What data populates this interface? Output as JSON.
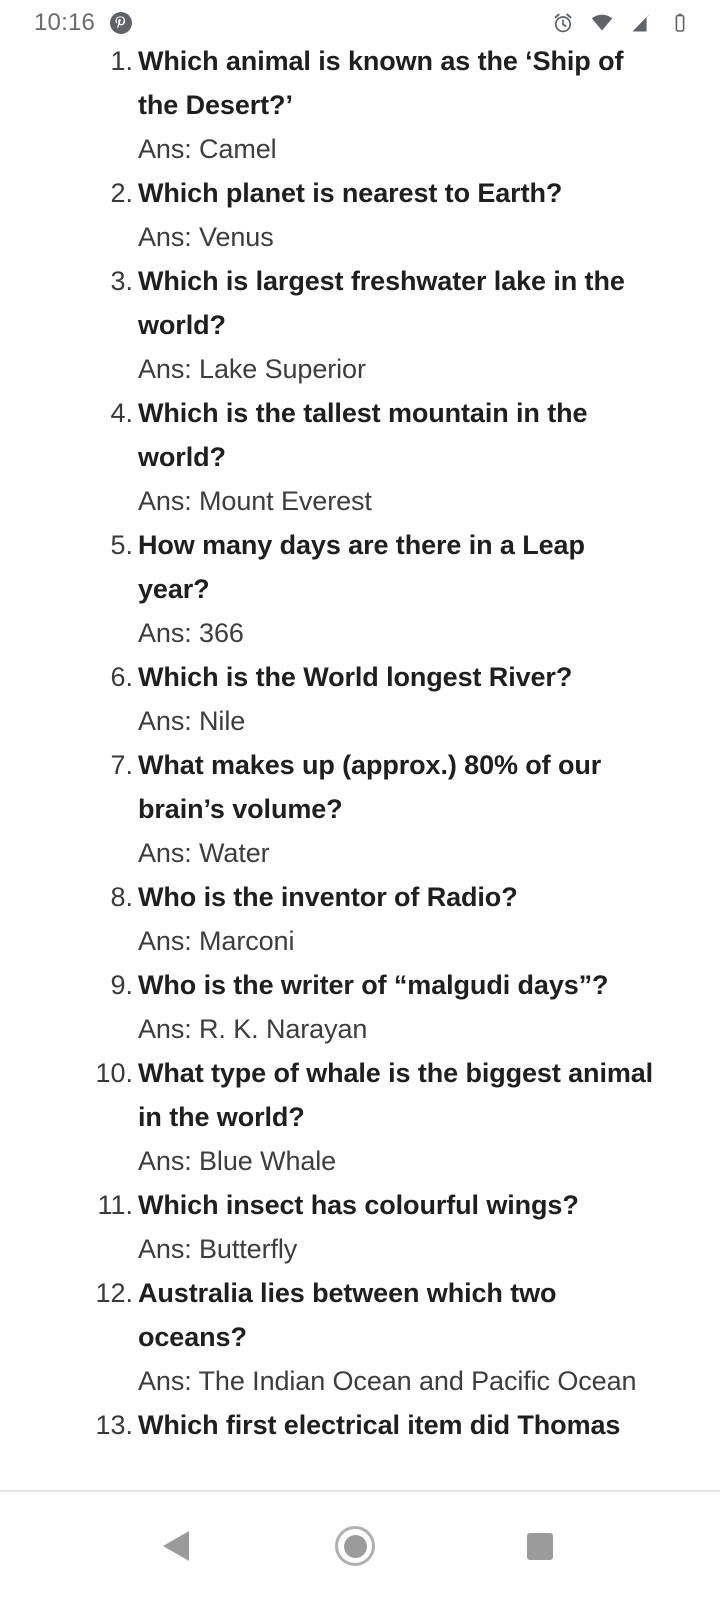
{
  "status_bar": {
    "time": "10:16",
    "icons": [
      {
        "name": "pinterest-icon",
        "label": "Pinterest"
      },
      {
        "name": "alarm-clock-icon",
        "label": "Alarm"
      },
      {
        "name": "wifi-icon",
        "label": "Wi-Fi"
      },
      {
        "name": "cellular-signal-icon",
        "label": "Signal"
      },
      {
        "name": "battery-icon",
        "label": "Battery"
      }
    ],
    "icon_color": "#5f6368",
    "text_color": "#6b6b6b"
  },
  "content": {
    "answer_prefix": "Ans:",
    "items": [
      {
        "number": "1.",
        "question": "Which animal is known as the ‘Ship of the Desert?’",
        "answer": "Ans: Camel",
        "clipped_top": true
      },
      {
        "number": "2.",
        "question": "Which planet is nearest to Earth?",
        "answer": "Ans: Venus"
      },
      {
        "number": "3.",
        "question": "Which is largest freshwater lake in the world?",
        "answer": "Ans: Lake Superior"
      },
      {
        "number": "4.",
        "question": "Which is the tallest mountain in the world?",
        "answer": "Ans: Mount Everest"
      },
      {
        "number": "5.",
        "question": "How many days are there in a Leap year?",
        "answer": "Ans: 366"
      },
      {
        "number": "6.",
        "question": "Which is the World longest River?",
        "answer": "Ans: Nile"
      },
      {
        "number": "7.",
        "question": "What makes up (approx.) 80% of our brain’s volume?",
        "answer": "Ans: Water"
      },
      {
        "number": "8.",
        "question": "Who is the inventor of Radio?",
        "answer": "Ans: Marconi"
      },
      {
        "number": "9.",
        "question": "Who is the writer of “malgudi days”?",
        "answer": "Ans: R. K. Narayan"
      },
      {
        "number": "10.",
        "question": "What type of whale is the biggest animal in the world?",
        "answer": "Ans: Blue Whale"
      },
      {
        "number": "11.",
        "question": "Which insect has colourful wings?",
        "answer": "Ans: Butterfly"
      },
      {
        "number": "12.",
        "question": "Australia lies between which two oceans?",
        "answer": "Ans: The Indian Ocean and Pacific Ocean"
      },
      {
        "number": "13.",
        "question": "Which first electrical item did Thomas",
        "answer": "",
        "clipped_bottom": true
      }
    ]
  },
  "nav_bar": {
    "buttons": [
      {
        "name": "back-button",
        "label": "Back"
      },
      {
        "name": "home-button",
        "label": "Home"
      },
      {
        "name": "recents-button",
        "label": "Recents"
      }
    ],
    "icon_color": "#9b9b9b",
    "divider_color": "#e4e4e4"
  }
}
